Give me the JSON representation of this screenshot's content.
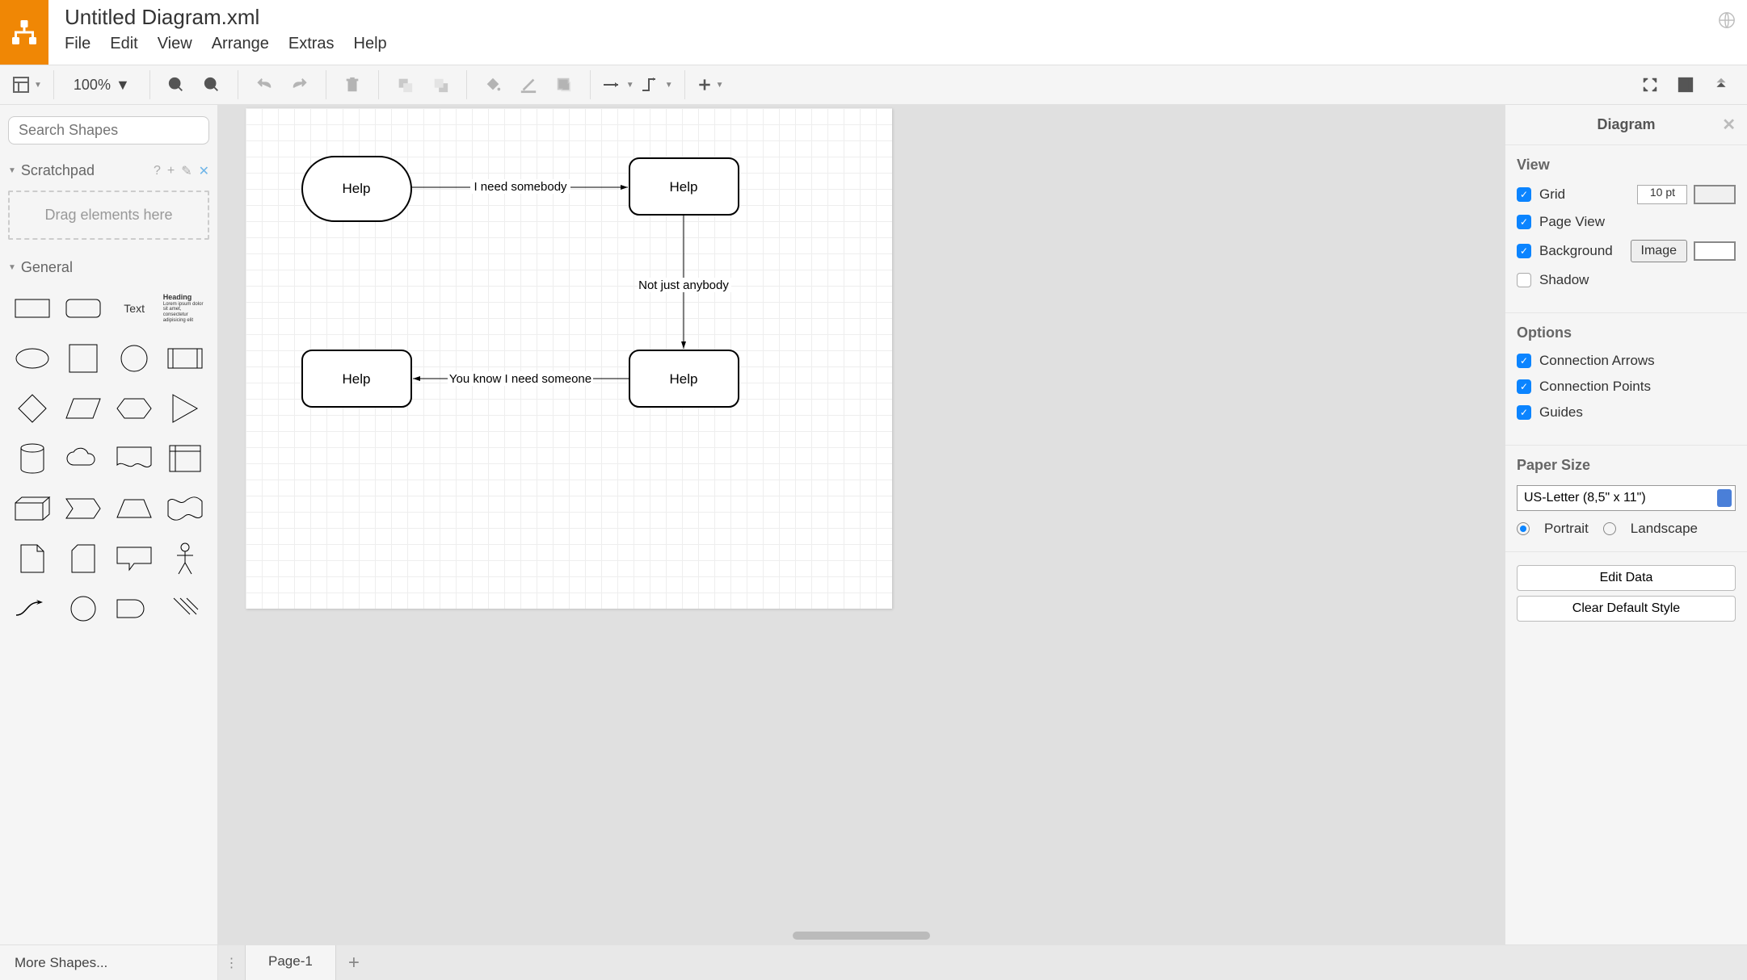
{
  "title": "Untitled Diagram.xml",
  "menubar": [
    "File",
    "Edit",
    "View",
    "Arrange",
    "Extras",
    "Help"
  ],
  "toolbar": {
    "zoom": "100%"
  },
  "left": {
    "search_placeholder": "Search Shapes",
    "scratchpad_label": "Scratchpad",
    "dropzone": "Drag elements here",
    "general_label": "General",
    "text_label": "Text",
    "heading_title": "Heading",
    "heading_body": "Lorem ipsum dolor sit amet, consectetur adipisicing elit",
    "more_shapes": "More Shapes..."
  },
  "diagram": {
    "nodes": [
      {
        "id": "n1",
        "label": "Help"
      },
      {
        "id": "n2",
        "label": "Help"
      },
      {
        "id": "n3",
        "label": "Help"
      },
      {
        "id": "n4",
        "label": "Help"
      }
    ],
    "edges": [
      {
        "label": "I need somebody"
      },
      {
        "label": "Not just anybody"
      },
      {
        "label": "You know I need someone"
      }
    ]
  },
  "tabs": {
    "page1": "Page-1"
  },
  "right": {
    "title": "Diagram",
    "view_heading": "View",
    "grid": "Grid",
    "grid_size": "10 pt",
    "page_view": "Page View",
    "background": "Background",
    "image_btn": "Image",
    "shadow": "Shadow",
    "options_heading": "Options",
    "conn_arrows": "Connection Arrows",
    "conn_points": "Connection Points",
    "guides": "Guides",
    "paper_heading": "Paper Size",
    "paper_option": "US-Letter (8,5\" x 11\")",
    "portrait": "Portrait",
    "landscape": "Landscape",
    "edit_data": "Edit Data",
    "clear_style": "Clear Default Style"
  }
}
